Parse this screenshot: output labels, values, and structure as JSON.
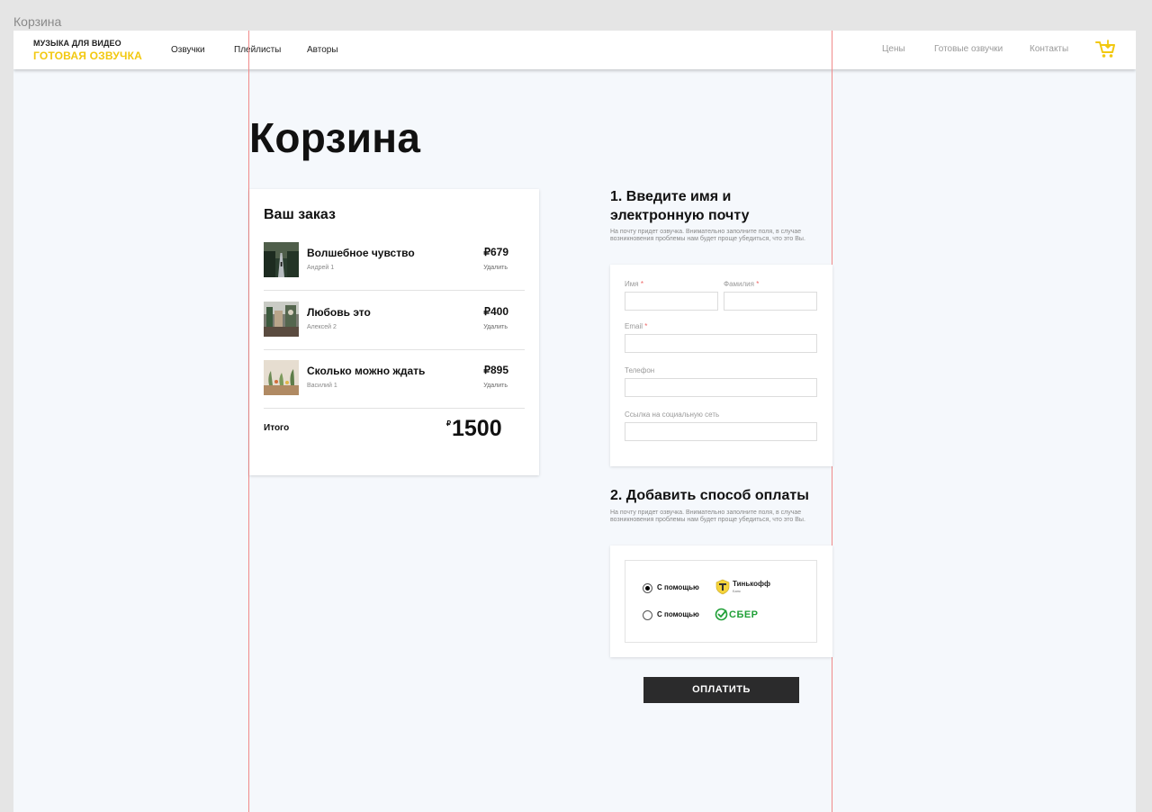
{
  "frame_label": "Корзина",
  "header": {
    "logo_top": "МУЗЫКА ДЛЯ ВИДЕО",
    "logo_bottom": "ГОТОВАЯ ОЗВУЧКА",
    "nav_left": [
      "Озвучки",
      "Плейлисты",
      "Авторы"
    ],
    "nav_right": [
      "Цены",
      "Готовые озвучки",
      "Контакты"
    ],
    "cart_icon": "cart-icon",
    "accent_color": "#f2c80f"
  },
  "page_title": "Корзина",
  "order": {
    "title": "Ваш заказ",
    "items": [
      {
        "name": "Волшебное чувство",
        "author": "Андрей 1",
        "price": "₽679",
        "remove_label": "Удалить"
      },
      {
        "name": "Любовь это",
        "author": "Алексей 2",
        "price": "₽400",
        "remove_label": "Удалить"
      },
      {
        "name": "Сколько можно ждать",
        "author": "Василий 1",
        "price": "₽895",
        "remove_label": "Удалить"
      }
    ],
    "total_label": "Итого",
    "total_currency": "₽",
    "total_value": "1500"
  },
  "contact_section": {
    "title": "1. Введите имя и электронную почту",
    "description": "На почту придет озвучка. Внимательно заполните поля, в случае возникновения проблемы нам будет проще убедиться, что это Вы.",
    "fields": {
      "first_name_label": "Имя",
      "last_name_label": "Фамилия",
      "email_label": "Email",
      "phone_label": "Телефон",
      "social_label": "Ссылка на социальную сеть",
      "required_mark": "*"
    }
  },
  "payment_section": {
    "title": "2. Добавить способ оплаты",
    "description": "На почту придет озвучка. Внимательно заполните поля, в случае возникновения проблемы нам будет проще убедиться, что это Вы.",
    "options": [
      {
        "label": "С помощью",
        "provider": "Тинькофф",
        "provider_sub": "Банк",
        "selected": true
      },
      {
        "label": "С помощью",
        "provider": "СБЕР",
        "selected": false
      }
    ],
    "button_label": "ОПЛАТИТЬ"
  }
}
